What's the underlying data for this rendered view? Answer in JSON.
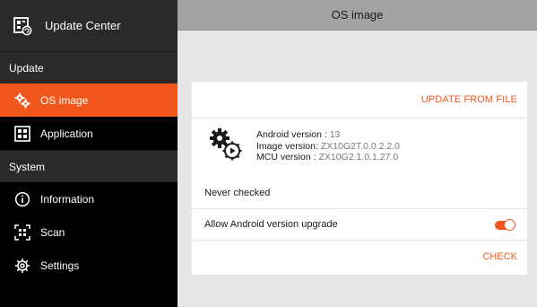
{
  "sidebar": {
    "header_title": "Update Center",
    "sections": {
      "update": "Update",
      "system": "System"
    },
    "items": {
      "os_image": "OS image",
      "application": "Application",
      "information": "Information",
      "scan": "Scan",
      "settings": "Settings"
    }
  },
  "topbar": {
    "title": "OS image"
  },
  "main": {
    "update_from_file": "UPDATE FROM FILE",
    "android_version_label": "Android version :",
    "android_version_value": "13",
    "image_version_label": "Image version:",
    "image_version_value": "ZX10G2T.0.0.2.2.0",
    "mcu_version_label": "MCU version :",
    "mcu_version_value": "ZX10G2.1.0.1.27.0",
    "check_status": "Never checked",
    "allow_upgrade_label": "Allow Android version upgrade",
    "allow_upgrade_on": true,
    "check_button": "CHECK"
  },
  "colors": {
    "accent": "#f1561a",
    "sidebar_bg": "#000000",
    "sidebar_section_bg": "#2a2a2a",
    "topbar_bg": "#a3a3a3",
    "content_bg": "#e6e6e6"
  },
  "icons": {
    "header": "update-center-icon",
    "os_image": "gears-icon",
    "application": "grid-icon",
    "information": "info-icon",
    "scan": "scan-icon",
    "settings": "settings-gear-icon",
    "os_info": "gears-icon"
  }
}
